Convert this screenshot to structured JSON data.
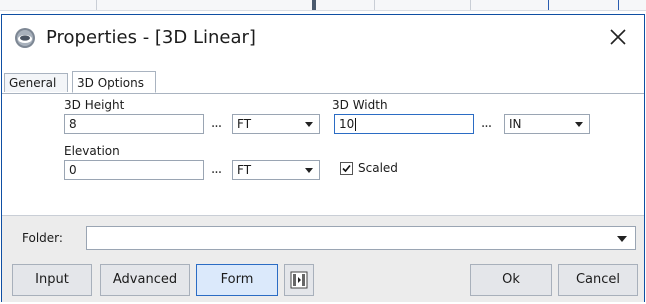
{
  "window": {
    "title": "Properties - [3D Linear]"
  },
  "tabs": [
    {
      "label": "General"
    },
    {
      "label": "3D Options"
    }
  ],
  "fields": {
    "height": {
      "label": "3D Height",
      "value": "8",
      "browse": "...",
      "unit": "FT"
    },
    "width": {
      "label": "3D Width",
      "value": "10",
      "browse": "...",
      "unit": "IN"
    },
    "elevation": {
      "label": "Elevation",
      "value": "0",
      "browse": "...",
      "unit": "FT"
    },
    "scaled": {
      "label": "Scaled",
      "checked": true
    }
  },
  "footer": {
    "folder_label": "Folder:",
    "folder_value": "",
    "buttons": {
      "input": "Input",
      "advanced": "Advanced",
      "form": "Form",
      "ok": "Ok",
      "cancel": "Cancel"
    }
  },
  "icons": {
    "app": "app-logo-icon",
    "close": "close-icon",
    "browse": "ellipsis-icon",
    "dropdown": "chevron-down-icon",
    "check": "checkmark-icon",
    "layout": "panel-toggle-icon"
  },
  "colors": {
    "accent": "#2b6cc4",
    "window_border": "#0f4fa3",
    "footer_bg": "#ececec"
  }
}
